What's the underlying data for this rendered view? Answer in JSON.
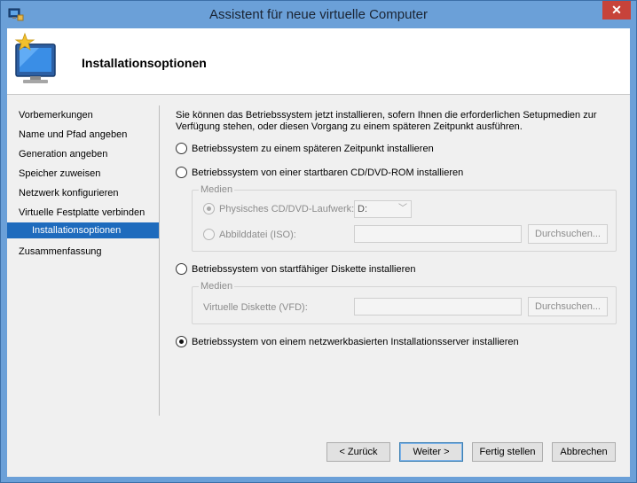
{
  "window": {
    "title": "Assistent für neue virtuelle Computer",
    "close_glyph": "✕"
  },
  "header": {
    "title": "Installationsoptionen",
    "icon": "monitor-with-sparkle-icon"
  },
  "nav": {
    "items": [
      {
        "label": "Vorbemerkungen"
      },
      {
        "label": "Name und Pfad angeben"
      },
      {
        "label": "Generation angeben"
      },
      {
        "label": "Speicher zuweisen"
      },
      {
        "label": "Netzwerk konfigurieren"
      },
      {
        "label": "Virtuelle Festplatte verbinden"
      },
      {
        "label": "Installationsoptionen",
        "selected": true
      },
      {
        "label": "Zusammenfassung"
      }
    ]
  },
  "main": {
    "intro": "Sie können das Betriebssystem jetzt installieren, sofern Ihnen die erforderlichen Setupmedien zur Verfügung stehen, oder diesen Vorgang zu einem späteren Zeitpunkt ausführen.",
    "options": [
      {
        "label": "Betriebssystem zu einem späteren Zeitpunkt installieren",
        "checked": false
      },
      {
        "label": "Betriebssystem von einer startbaren CD/DVD-ROM installieren",
        "checked": false
      },
      {
        "label": "Betriebssystem von startfähiger Diskette installieren",
        "checked": false
      },
      {
        "label": "Betriebssystem von einem netzwerkbasierten Installationsserver installieren",
        "checked": true
      }
    ],
    "cd_group": {
      "legend": "Medien",
      "physical_label": "Physisches CD/DVD-Laufwerk:",
      "drive_value": "D:",
      "image_label": "Abbilddatei (ISO):",
      "image_value": "",
      "browse_label": "Durchsuchen..."
    },
    "floppy_group": {
      "legend": "Medien",
      "vfd_label": "Virtuelle Diskette (VFD):",
      "vfd_value": "",
      "browse_label": "Durchsuchen..."
    }
  },
  "footer": {
    "back": "< Zurück",
    "next": "Weiter >",
    "finish": "Fertig stellen",
    "cancel": "Abbrechen"
  },
  "colors": {
    "titlebar": "#6ba0d8",
    "selection": "#1e6bbd",
    "close": "#c7433a"
  }
}
